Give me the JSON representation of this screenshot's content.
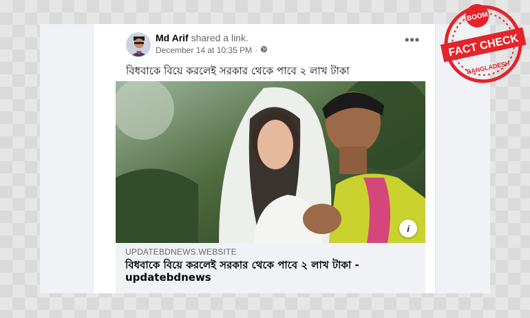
{
  "post": {
    "author": "Md Arif",
    "action": "shared a link.",
    "timestamp": "December 14 at 10:35 PM",
    "separator": "·",
    "privacy_icon": "globe-icon",
    "more_label": "•••",
    "text": "বিধবাকে বিয়ে করলেই সরকার থেকে পাবে ২ লাখ টাকা"
  },
  "link_preview": {
    "domain": "UPDATEBDNEWS.WEBSITE",
    "title": "বিধবাকে বিয়ে করলেই সরকার থেকে পাবে ২ লাখ টাকা - updatebdnews",
    "info_label": "i"
  },
  "stamp": {
    "top_text": "BOOM",
    "main_text": "FACT CHECK",
    "bottom_text": "BANGLADESH",
    "color": "#e3242b"
  }
}
